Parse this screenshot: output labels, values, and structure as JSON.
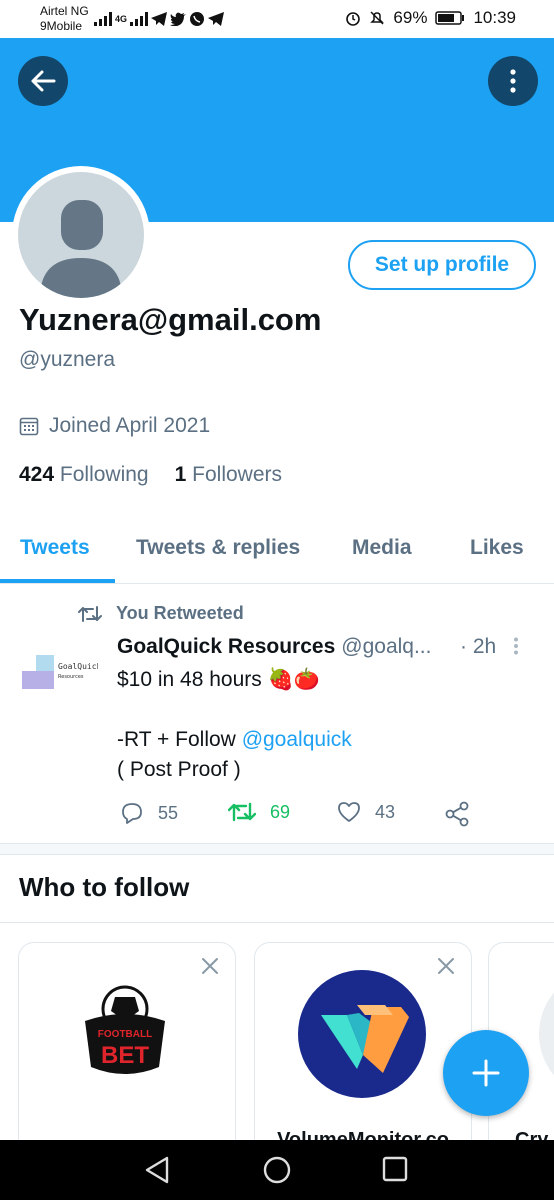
{
  "status_bar": {
    "carrier_line1": "Airtel NG",
    "carrier_line2": "9Mobile",
    "network_label": "4G",
    "battery": "69%",
    "time": "10:39"
  },
  "profile": {
    "setup_button": "Set up profile",
    "display_name": "Yuznera@gmail.com",
    "handle": "@yuznera",
    "joined": "Joined April 2021",
    "following_count": "424",
    "following_label": "Following",
    "followers_count": "1",
    "followers_label": "Followers"
  },
  "tabs": [
    "Tweets",
    "Tweets & replies",
    "Media",
    "Likes"
  ],
  "tweet": {
    "retweet_label": "You Retweeted",
    "author_name": "GoalQuick Resources",
    "author_handle": "@goalq...",
    "time": "· 2h",
    "avatar_text_1": "GoalQuick",
    "avatar_text_2": "Resources",
    "line1": "$10 in 48 hours 🍓🍅",
    "line2_prefix": "-RT + Follow ",
    "mention": "@goalquick",
    "line3": "( Post Proof )",
    "replies": "55",
    "retweets": "69",
    "likes": "43"
  },
  "who_to_follow": {
    "title": "Who to follow",
    "cards": [
      {
        "name": "",
        "logo_text_1": "FOOTBALL",
        "logo_text_2": "BET"
      },
      {
        "name": "VolumeMonitor.co"
      },
      {
        "name": "Cry"
      }
    ]
  },
  "colors": {
    "accent": "#1da1f2",
    "retweet_green": "#17bf63",
    "muted_text": "#5b7083"
  }
}
